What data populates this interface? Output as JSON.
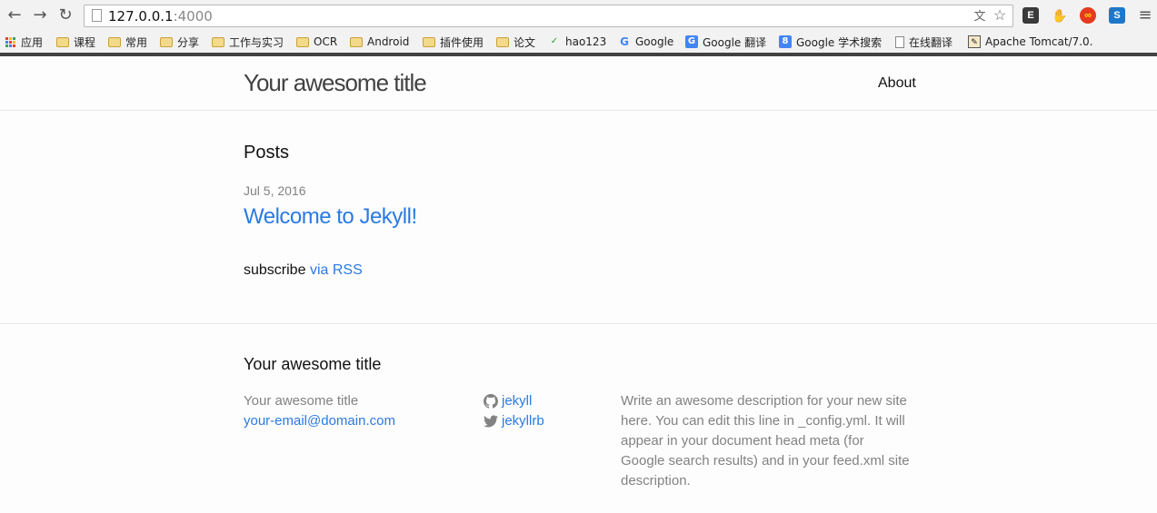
{
  "browser": {
    "url_host": "127.0.0.1",
    "url_port": ":4000",
    "bookmarks": [
      {
        "label": "应用",
        "icon": "apps-icon"
      },
      {
        "label": "课程",
        "icon": "folder-icon"
      },
      {
        "label": "常用",
        "icon": "folder-icon"
      },
      {
        "label": "分享",
        "icon": "folder-icon"
      },
      {
        "label": "工作与实习",
        "icon": "folder-icon"
      },
      {
        "label": "OCR",
        "icon": "folder-icon"
      },
      {
        "label": "Android",
        "icon": "folder-icon"
      },
      {
        "label": "插件使用",
        "icon": "folder-icon"
      },
      {
        "label": "论文",
        "icon": "folder-icon"
      },
      {
        "label": "hao123",
        "icon": "hao123-icon"
      },
      {
        "label": "Google",
        "icon": "google-icon"
      },
      {
        "label": "Google 翻译",
        "icon": "google-translate-icon"
      },
      {
        "label": "Google 学术搜索",
        "icon": "google-scholar-icon"
      },
      {
        "label": "在线翻译",
        "icon": "page-icon"
      },
      {
        "label": "Apache Tomcat/7.0.",
        "icon": "tomcat-icon"
      }
    ],
    "overflow_label": "»"
  },
  "header": {
    "site_title": "Your awesome title",
    "nav_about": "About"
  },
  "main": {
    "posts_heading": "Posts",
    "posts": [
      {
        "date": "Jul 5, 2016",
        "title": "Welcome to Jekyll!"
      }
    ],
    "subscribe_text": "subscribe",
    "rss_link": "via RSS"
  },
  "footer": {
    "heading": "Your awesome title",
    "name": "Your awesome title",
    "email": "your-email@domain.com",
    "github": "jekyll",
    "twitter": "jekyllrb",
    "description": "Write an awesome description for your new site here. You can edit this line in _config.yml. It will appear in your document head meta (for Google search results) and in your feed.xml site description."
  },
  "colors": {
    "link": "#2a7ae2",
    "muted": "#828282",
    "text": "#111111"
  }
}
